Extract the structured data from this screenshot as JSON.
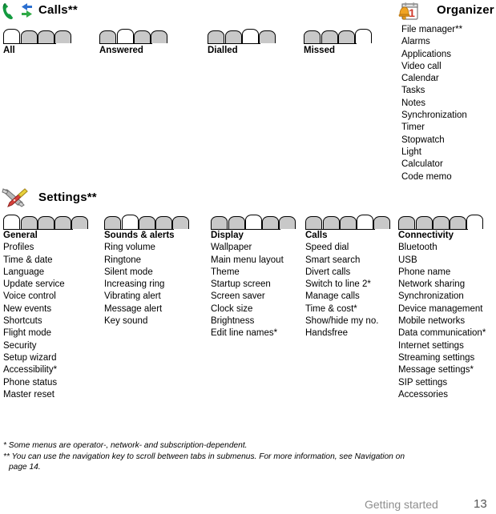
{
  "sections": [
    {
      "id": "calls",
      "icon": "phone-calls-icon",
      "title": "Calls**",
      "tab_count": 4,
      "tabs": [
        {
          "label": "All",
          "selected_index": 0
        },
        {
          "label": "Answered",
          "selected_index": 1
        },
        {
          "label": "Dialled",
          "selected_index": 2
        },
        {
          "label": "Missed",
          "selected_index": 3
        }
      ]
    },
    {
      "id": "settings",
      "icon": "tools-settings-icon",
      "title": "Settings**",
      "tab_count": 5,
      "columns": [
        {
          "head": "General",
          "selected_index": 0,
          "items": [
            "Profiles",
            "Time & date",
            "Language",
            "Update service",
            "Voice control",
            "New events",
            "Shortcuts",
            "Flight mode",
            "Security",
            "Setup wizard",
            "Accessibility*",
            "Phone status",
            "Master reset"
          ]
        },
        {
          "head": "Sounds & alerts",
          "selected_index": 1,
          "items": [
            "Ring volume",
            "Ringtone",
            "Silent mode",
            "Increasing ring",
            "Vibrating alert",
            "Message alert",
            "Key sound"
          ]
        },
        {
          "head": "Display",
          "selected_index": 2,
          "items": [
            "Wallpaper",
            "Main menu layout",
            "Theme",
            "Startup screen",
            "Screen saver",
            "Clock size",
            "Brightness",
            "Edit line names*"
          ]
        },
        {
          "head": "Calls",
          "selected_index": 3,
          "items": [
            "Speed dial",
            "Smart search",
            "Divert calls",
            "Switch to line 2*",
            "Manage calls",
            "Time & cost*",
            "Show/hide my no.",
            "Handsfree"
          ]
        },
        {
          "head": "Connectivity",
          "selected_index": 4,
          "items": [
            "Bluetooth",
            "USB",
            "Phone name",
            "Network sharing",
            "Synchronization",
            "Device management",
            "Mobile networks",
            "Data communication*",
            "Internet settings",
            "Streaming settings",
            "Message settings*",
            "SIP settings",
            "Accessories"
          ]
        }
      ]
    },
    {
      "id": "organizer",
      "icon": "calendar-alarm-icon",
      "title": "Organizer",
      "items": [
        "File manager**",
        "Alarms",
        "Applications",
        "Video call",
        "Calendar",
        "Tasks",
        "Notes",
        "Synchronization",
        "Timer",
        "Stopwatch",
        "Light",
        "Calculator",
        "Code memo"
      ]
    }
  ],
  "footnotes": {
    "line1": "* Some menus are operator-, network- and subscription-dependent.",
    "line2": "** You can use the navigation key to scroll between tabs in submenus. For more information, see Navigation on",
    "line3": "page 14."
  },
  "footer": {
    "chapter": "Getting started",
    "page_number": "13"
  },
  "colors": {
    "tab_unselected": "#c8c8c8",
    "tab_selected": "#ffffff",
    "footer_text": "#8e8e8e",
    "footer_page": "#555555"
  }
}
